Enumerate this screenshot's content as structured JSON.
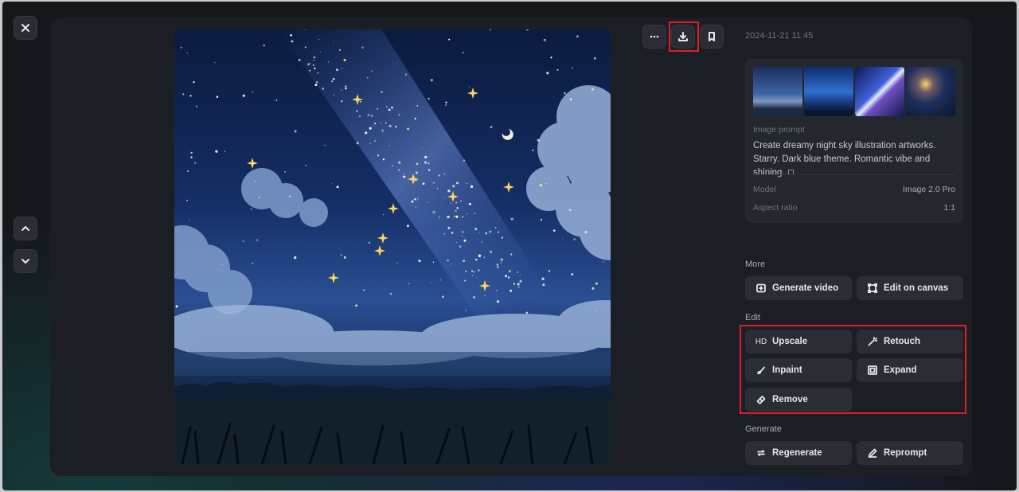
{
  "viewer": {
    "close_icon": "close-icon",
    "prev_icon": "chevron-up-icon",
    "next_icon": "chevron-down-icon"
  },
  "toolbar": {
    "more_icon": "more-icon",
    "download_icon": "download-icon",
    "bookmark_icon": "bookmark-icon",
    "highlight_color": "#e11d2a"
  },
  "details": {
    "timestamp": "2024-11-21 11:45",
    "prompt_label": "Image prompt",
    "prompt_text": "Create dreamy night sky illustration artworks. Starry. Dark blue theme. Romantic vibe and shining.",
    "model_label": "Model",
    "model_value": "Image 2.0 Pro",
    "ratio_label": "Aspect ratio",
    "ratio_value": "1:1"
  },
  "sections": {
    "more": {
      "label": "More",
      "buttons": [
        {
          "label": "Generate video",
          "icon": "video-plus-icon"
        },
        {
          "label": "Edit on canvas",
          "icon": "canvas-icon"
        }
      ]
    },
    "edit": {
      "label": "Edit",
      "buttons": [
        {
          "label": "Upscale",
          "icon": "HD"
        },
        {
          "label": "Retouch",
          "icon": "magic-wand-icon"
        },
        {
          "label": "Inpaint",
          "icon": "brush-icon"
        },
        {
          "label": "Expand",
          "icon": "expand-icon"
        },
        {
          "label": "Remove",
          "icon": "eraser-icon"
        }
      ]
    },
    "generate": {
      "label": "Generate",
      "buttons": [
        {
          "label": "Regenerate",
          "icon": "refresh-icon"
        },
        {
          "label": "Reprompt",
          "icon": "pencil-icon"
        }
      ]
    }
  }
}
